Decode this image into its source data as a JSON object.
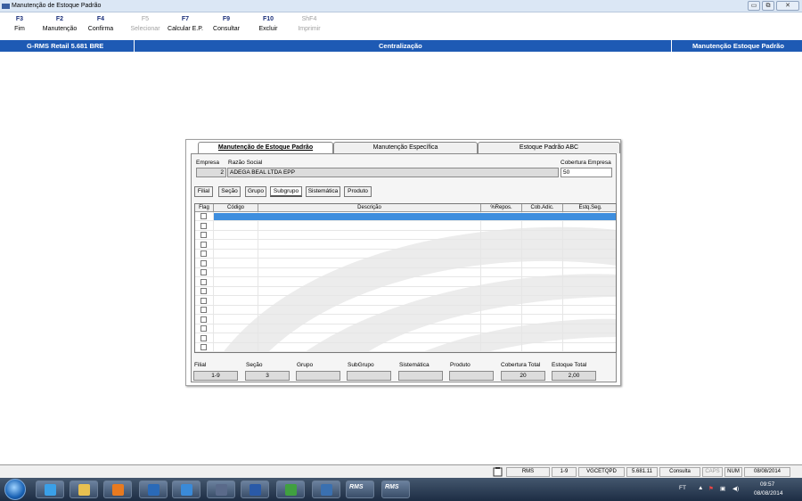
{
  "window": {
    "title": "Manutenção de Estoque Padrão",
    "btn_min": "▭",
    "btn_restore": "⧉",
    "btn_close": "✕"
  },
  "toolbar": [
    {
      "key": "F3",
      "label": "Fim",
      "enabled": true
    },
    {
      "key": "F2",
      "label": "Manutenção",
      "enabled": true
    },
    {
      "key": "F4",
      "label": "Confirma",
      "enabled": true
    },
    {
      "key": "F5",
      "label": "Selecionar",
      "enabled": false
    },
    {
      "key": "F7",
      "label": "Calcular E.P.",
      "enabled": true
    },
    {
      "key": "F9",
      "label": "Consultar",
      "enabled": true
    },
    {
      "key": "F10",
      "label": "Excluir",
      "enabled": true
    },
    {
      "key": "ShF4",
      "label": "Imprimir",
      "enabled": false
    }
  ],
  "banner": {
    "left": "G-RMS Retail 5.681 BRE",
    "center": "Centralização",
    "right": "Manutenção Estoque Padrão",
    "color": "#1e5ab4"
  },
  "tabs": [
    "Manutenção de Estoque Padrão",
    "Manutenção Específica",
    "Estoque Padrão ABC"
  ],
  "header": {
    "empresa_label": "Empresa",
    "empresa_value": "2",
    "razao_label": "Razão Social",
    "razao_value": "ADEGA BEAL LTDA EPP",
    "cobertura_label": "Cobertura Empresa",
    "cobertura_value": "50"
  },
  "subtabs": [
    "Filial",
    "Seção",
    "Grupo",
    "Subgrupo",
    "Sistemática",
    "Produto"
  ],
  "grid": {
    "columns": [
      "Flag",
      "Código",
      "Descrição",
      "%Repos.",
      "Cob.Adic.",
      "Estq.Seg."
    ],
    "selected_color": "#3e8ede"
  },
  "footer": [
    {
      "label": "Filial",
      "value": "1-9"
    },
    {
      "label": "Seção",
      "value": "3"
    },
    {
      "label": "Grupo",
      "value": ""
    },
    {
      "label": "SubGrupo",
      "value": ""
    },
    {
      "label": "Sistemática",
      "value": ""
    },
    {
      "label": "Produto",
      "value": ""
    },
    {
      "label": "Cobertura Total",
      "value": "20"
    },
    {
      "label": "Estoque Total",
      "value": "2,00"
    }
  ],
  "status": {
    "app": "RMS",
    "filial": "1-9",
    "program": "VGCETQPD",
    "version": "5.681.11",
    "mode": "Consulta",
    "caps": "CAPS",
    "num": "NUM",
    "date": "08/08/2014"
  },
  "taskbar": {
    "lang": "FT",
    "time": "09:57",
    "date": "08/08/2014",
    "apps": [
      "ie-icon",
      "explorer-icon",
      "media-player-icon",
      "outlook-icon",
      "lync-icon",
      "network-icon",
      "word-icon",
      "app-plus-icon",
      "remote-icon",
      "rms-icon",
      "rms-icon-2"
    ],
    "rms_label": "RMS"
  }
}
